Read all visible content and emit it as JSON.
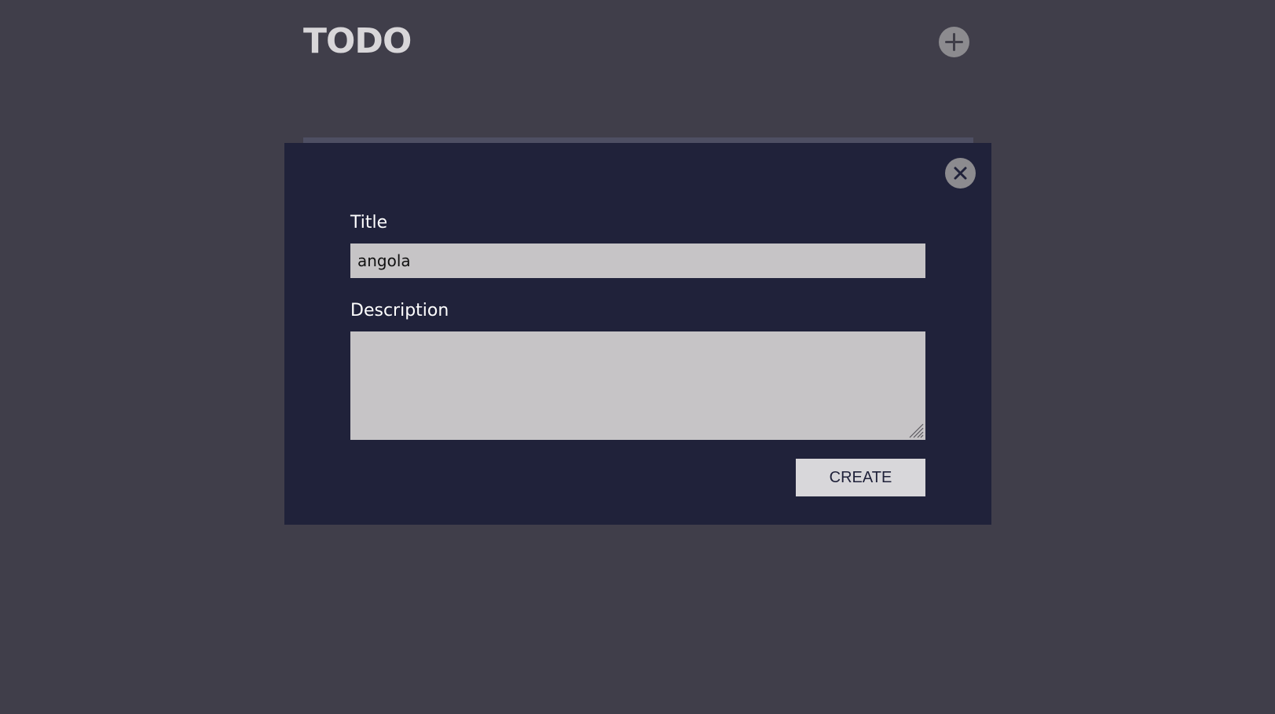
{
  "header": {
    "title": "TODO",
    "add_icon": "plus-icon"
  },
  "modal": {
    "close_icon": "close-icon",
    "title_field": {
      "label": "Title",
      "value": "angola"
    },
    "description_field": {
      "label": "Description",
      "value": ""
    },
    "create_label": "CREATE"
  },
  "colors": {
    "background": "#403e4a",
    "modal_background": "#20223a",
    "input_background": "#c6c4c6",
    "button_background": "#d8d7da",
    "icon_button": "#8c8b8f"
  }
}
